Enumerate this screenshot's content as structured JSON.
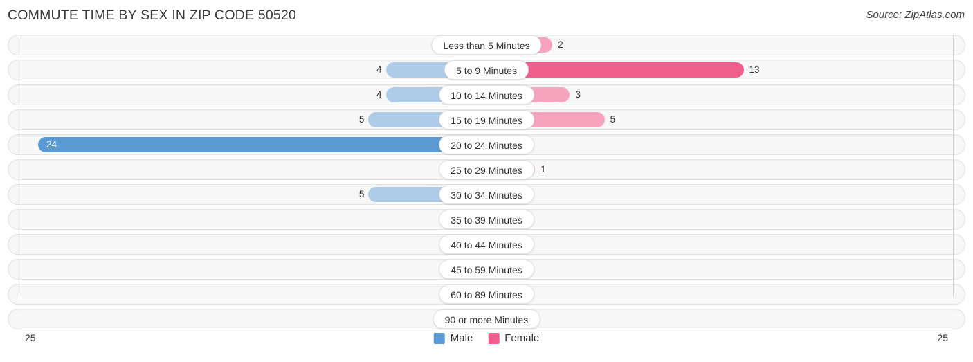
{
  "header": {
    "title": "COMMUTE TIME BY SEX IN ZIP CODE 50520",
    "source": "Source: ZipAtlas.com"
  },
  "legend": {
    "male_label": "Male",
    "female_label": "Female",
    "male_color": "#5b9bd5",
    "female_color": "#ef5e8c",
    "male_color_light": "#aecbe8",
    "female_color_light": "#f7a3be"
  },
  "axis": {
    "left_end_label": "25",
    "right_end_label": "25",
    "max": 25
  },
  "chart_data": {
    "type": "bar",
    "title": "COMMUTE TIME BY SEX IN ZIP CODE 50520",
    "subtitle": "Source: ZipAtlas.com",
    "orientation": "horizontal-diverging",
    "xlabel": "",
    "ylabel": "",
    "xlim": [
      25,
      25
    ],
    "grid": false,
    "legend_position": "bottom-center",
    "categories": [
      "Less than 5 Minutes",
      "5 to 9 Minutes",
      "10 to 14 Minutes",
      "15 to 19 Minutes",
      "20 to 24 Minutes",
      "25 to 29 Minutes",
      "30 to 34 Minutes",
      "35 to 39 Minutes",
      "40 to 44 Minutes",
      "45 to 59 Minutes",
      "60 to 89 Minutes",
      "90 or more Minutes"
    ],
    "series": [
      {
        "name": "Male",
        "values": [
          0,
          4,
          4,
          5,
          24,
          0,
          5,
          0,
          0,
          0,
          0,
          0
        ]
      },
      {
        "name": "Female",
        "values": [
          2,
          13,
          3,
          5,
          0,
          1,
          0,
          0,
          0,
          0,
          0,
          0
        ]
      }
    ],
    "rows": [
      {
        "category": "Less than 5 Minutes",
        "male": 0,
        "male_label": "0",
        "female": 2,
        "female_label": "2"
      },
      {
        "category": "5 to 9 Minutes",
        "male": 4,
        "male_label": "4",
        "female": 13,
        "female_label": "13"
      },
      {
        "category": "10 to 14 Minutes",
        "male": 4,
        "male_label": "4",
        "female": 3,
        "female_label": "3"
      },
      {
        "category": "15 to 19 Minutes",
        "male": 5,
        "male_label": "5",
        "female": 5,
        "female_label": "5"
      },
      {
        "category": "20 to 24 Minutes",
        "male": 24,
        "male_label": "24",
        "female": 0,
        "female_label": "0"
      },
      {
        "category": "25 to 29 Minutes",
        "male": 0,
        "male_label": "0",
        "female": 1,
        "female_label": "1"
      },
      {
        "category": "30 to 34 Minutes",
        "male": 5,
        "male_label": "5",
        "female": 0,
        "female_label": "0"
      },
      {
        "category": "35 to 39 Minutes",
        "male": 0,
        "male_label": "0",
        "female": 0,
        "female_label": "0"
      },
      {
        "category": "40 to 44 Minutes",
        "male": 0,
        "male_label": "0",
        "female": 0,
        "female_label": "0"
      },
      {
        "category": "45 to 59 Minutes",
        "male": 0,
        "male_label": "0",
        "female": 0,
        "female_label": "0"
      },
      {
        "category": "60 to 89 Minutes",
        "male": 0,
        "male_label": "0",
        "female": 0,
        "female_label": "0"
      },
      {
        "category": "90 or more Minutes",
        "male": 0,
        "male_label": "0",
        "female": 0,
        "female_label": "0"
      }
    ]
  }
}
